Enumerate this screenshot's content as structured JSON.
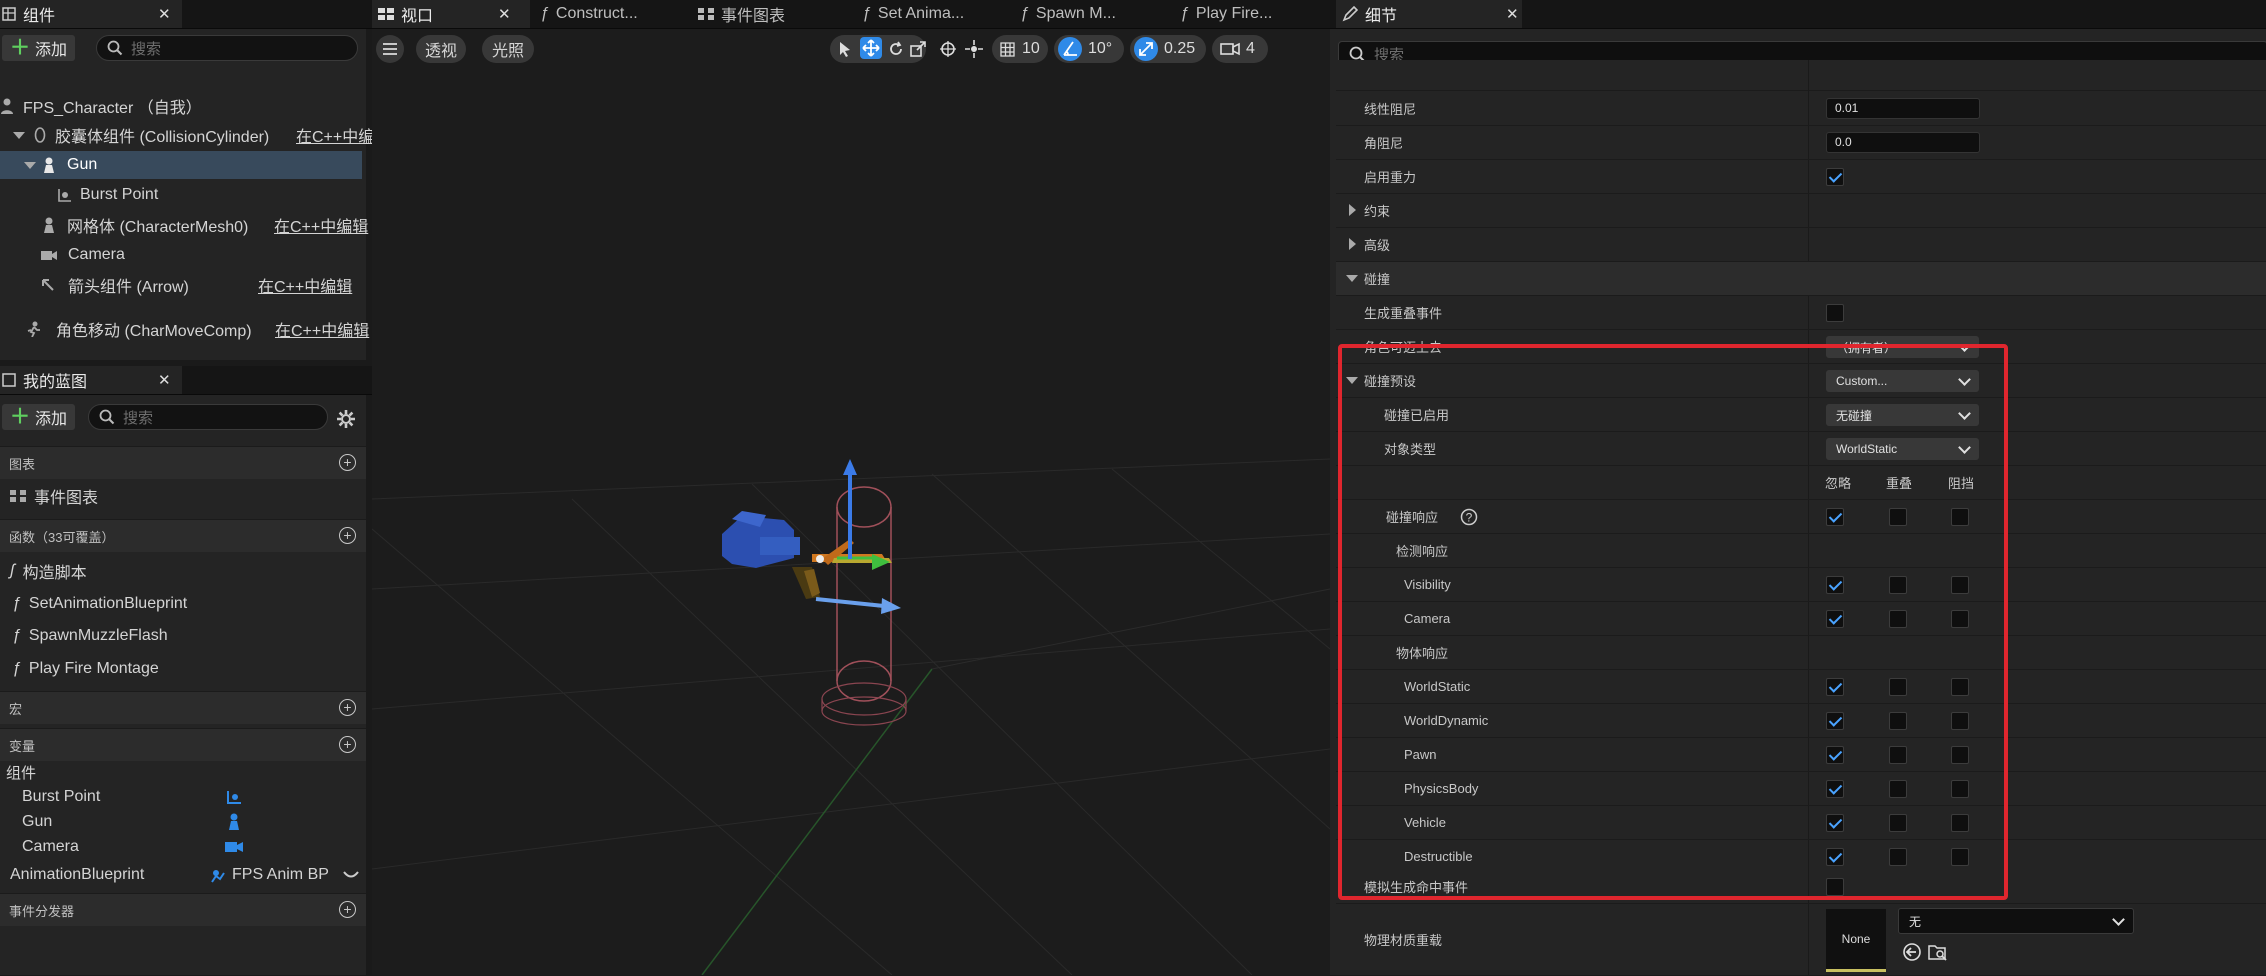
{
  "components_panel": {
    "tab_label": "组件",
    "add_label": "添加",
    "search_placeholder": "搜索",
    "root": "FPS_Character （自我）",
    "items": [
      {
        "label": "胶囊体组件 (CollisionCylinder)",
        "note": "在C++中编"
      },
      {
        "label": "Gun",
        "note": ""
      },
      {
        "label": "Burst Point",
        "note": ""
      },
      {
        "label": "网格体 (CharacterMesh0)",
        "note": "在C++中编辑"
      },
      {
        "label": "Camera",
        "note": ""
      },
      {
        "label": "箭头组件 (Arrow)",
        "note": "在C++中编辑"
      },
      {
        "label": "角色移动 (CharMoveComp)",
        "note": "在C++中编辑"
      }
    ]
  },
  "blueprint_panel": {
    "tab_label": "我的蓝图",
    "add_label": "添加",
    "search_placeholder": "搜索",
    "graphs_label": "图表",
    "event_graph": "事件图表",
    "functions_label": "函数",
    "functions_count": "（33可覆盖）",
    "functions": [
      "构造脚本",
      "SetAnimationBlueprint",
      "SpawnMuzzleFlash",
      "Play Fire Montage"
    ],
    "macros_label": "宏",
    "variables_label": "变量",
    "components_group": "组件",
    "variables": [
      "Burst Point",
      "Gun",
      "Camera"
    ],
    "anim_var": "AnimationBlueprint",
    "anim_value": "FPS Anim BP",
    "dispatchers_label": "事件分发器"
  },
  "editor_tabs": [
    "视口",
    "Construct...",
    "事件图表",
    "Set Anima...",
    "Spawn M...",
    "Play Fire..."
  ],
  "viewport_toolbar": {
    "perspective": "透视",
    "lighting": "光照",
    "grid_size": "10",
    "rotation_snap": "10°",
    "scale_snap": "0.25",
    "camera_speed": "4"
  },
  "details_panel": {
    "tab_label": "细节",
    "search_placeholder": "搜索",
    "linear_damping_label": "线性阻尼",
    "linear_damping": "0.01",
    "angular_damping_label": "角阻尼",
    "angular_damping": "0.0",
    "gravity_label": "启用重力",
    "constraints_label": "约束",
    "advanced_label": "高级",
    "collision_label": "碰撞",
    "overlap_events_label": "生成重叠事件",
    "step_up_label": "角色可迈上去",
    "step_up_value": "（拥有者）",
    "preset_label": "碰撞预设",
    "preset_value": "Custom...",
    "enabled_label": "碰撞已启用",
    "enabled_value": "无碰撞",
    "object_type_label": "对象类型",
    "object_type_value": "WorldStatic",
    "col_ignore": "忽略",
    "col_overlap": "重叠",
    "col_block": "阻挡",
    "responses_label": "碰撞响应",
    "trace_label": "检测响应",
    "trace_rows": [
      "Visibility",
      "Camera"
    ],
    "object_label": "物体响应",
    "object_rows": [
      "WorldStatic",
      "WorldDynamic",
      "Pawn",
      "PhysicsBody",
      "Vehicle",
      "Destructible"
    ],
    "hit_events_label": "模拟生成命中事件",
    "phys_material_label": "物理材质重载",
    "phys_material_thumb": "None",
    "phys_material_value": "无"
  },
  "colors": {
    "highlight": "#e0262e",
    "accent": "#2f8ae8",
    "check": "#4aa3ff"
  }
}
